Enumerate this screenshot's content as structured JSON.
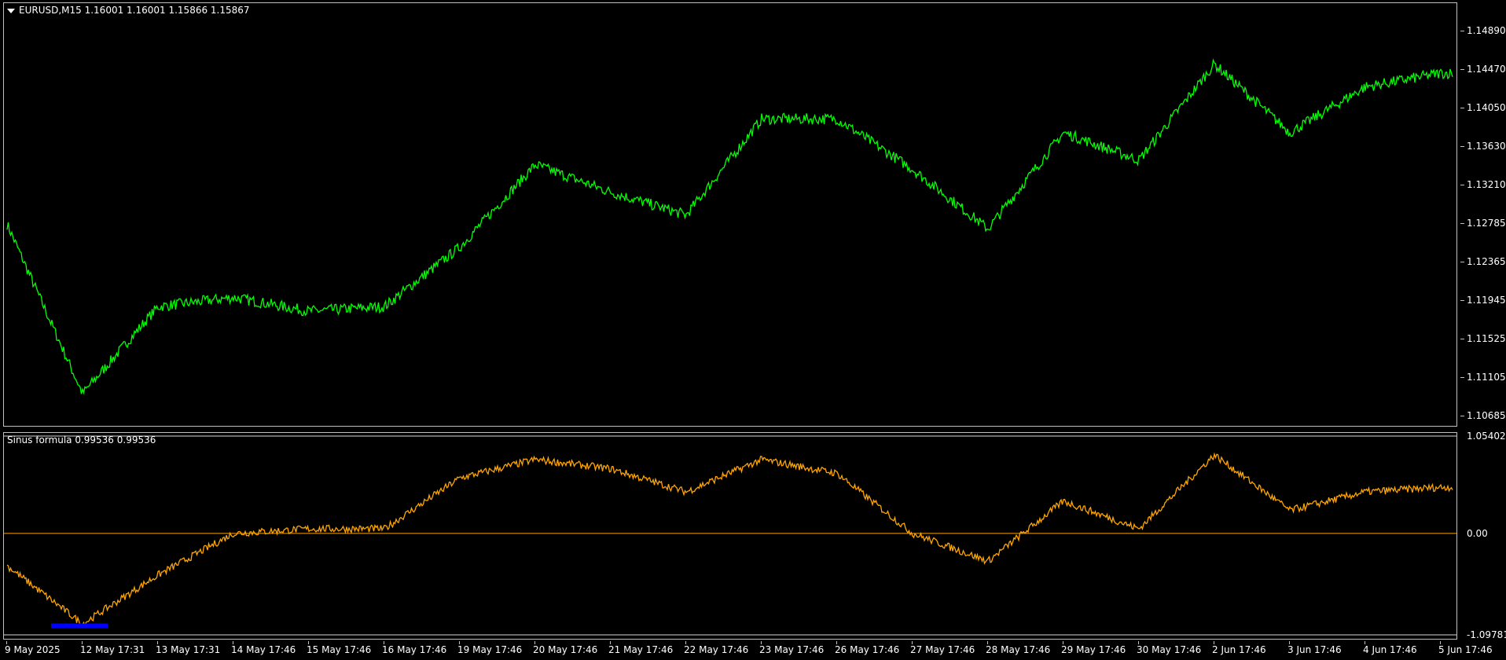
{
  "main_chart": {
    "title": "EURUSD,M15  1.16001 1.16001 1.15866 1.15867",
    "price_labels": [
      "1.14890",
      "1.14470",
      "1.14050",
      "1.13630",
      "1.13210",
      "1.12785",
      "1.12365",
      "1.11945",
      "1.11525",
      "1.11105",
      "1.10685"
    ],
    "line_color": "#00ff00"
  },
  "indicator": {
    "title": "Sinus formula 0.99536 0.99536",
    "scale_labels": [
      "1.05402",
      "0.00",
      "-1.09781"
    ],
    "line_color": "#ffa500",
    "level_color": "#ffa500",
    "highlight_color": "#0000ff"
  },
  "time_axis": {
    "labels": [
      "9 May 2025",
      "12 May 17:31",
      "13 May 17:31",
      "14 May 17:46",
      "15 May 17:46",
      "16 May 17:46",
      "19 May 17:46",
      "20 May 17:46",
      "21 May 17:46",
      "22 May 17:46",
      "23 May 17:46",
      "26 May 17:46",
      "27 May 17:46",
      "28 May 17:46",
      "29 May 17:46",
      "30 May 17:46",
      "2 Jun 17:46",
      "3 Jun 17:46",
      "4 Jun 17:46",
      "5 Jun 17:46"
    ]
  },
  "chart_data": [
    {
      "type": "line",
      "title": "EURUSD,M15",
      "x": [
        "9 May 2025",
        "12 May 17:31",
        "13 May 17:31",
        "14 May 17:46",
        "15 May 17:46",
        "16 May 17:46",
        "19 May 17:46",
        "20 May 17:46",
        "21 May 17:46",
        "22 May 17:46",
        "23 May 17:46",
        "26 May 17:46",
        "27 May 17:46",
        "28 May 17:46",
        "29 May 17:46",
        "30 May 17:46",
        "2 Jun 17:46",
        "3 Jun 17:46",
        "4 Jun 17:46",
        "5 Jun 17:46"
      ],
      "series": [
        {
          "name": "EURUSD",
          "values": [
            1.1275,
            1.109,
            1.1185,
            1.1195,
            1.118,
            1.1185,
            1.125,
            1.134,
            1.131,
            1.1285,
            1.139,
            1.139,
            1.1335,
            1.127,
            1.1375,
            1.1345,
            1.145,
            1.1375,
            1.1425,
            1.144
          ]
        }
      ],
      "ylim": [
        1.10685,
        1.1489
      ]
    },
    {
      "type": "line",
      "title": "Sinus formula",
      "x": [
        "9 May 2025",
        "12 May 17:31",
        "13 May 17:31",
        "14 May 17:46",
        "15 May 17:46",
        "16 May 17:46",
        "19 May 17:46",
        "20 May 17:46",
        "21 May 17:46",
        "22 May 17:46",
        "23 May 17:46",
        "26 May 17:46",
        "27 May 17:46",
        "28 May 17:46",
        "29 May 17:46",
        "30 May 17:46",
        "2 Jun 17:46",
        "3 Jun 17:46",
        "4 Jun 17:46",
        "5 Jun 17:46"
      ],
      "series": [
        {
          "name": "Sinus formula",
          "values": [
            -0.35,
            -0.98,
            -0.45,
            0.0,
            0.05,
            0.05,
            0.6,
            0.8,
            0.7,
            0.45,
            0.8,
            0.65,
            0.0,
            -0.3,
            0.35,
            0.05,
            0.85,
            0.25,
            0.45,
            0.5
          ]
        }
      ],
      "levels": [
        1.05402,
        0.0,
        -1.09781
      ],
      "ylim": [
        -1.09781,
        1.05402
      ]
    }
  ]
}
